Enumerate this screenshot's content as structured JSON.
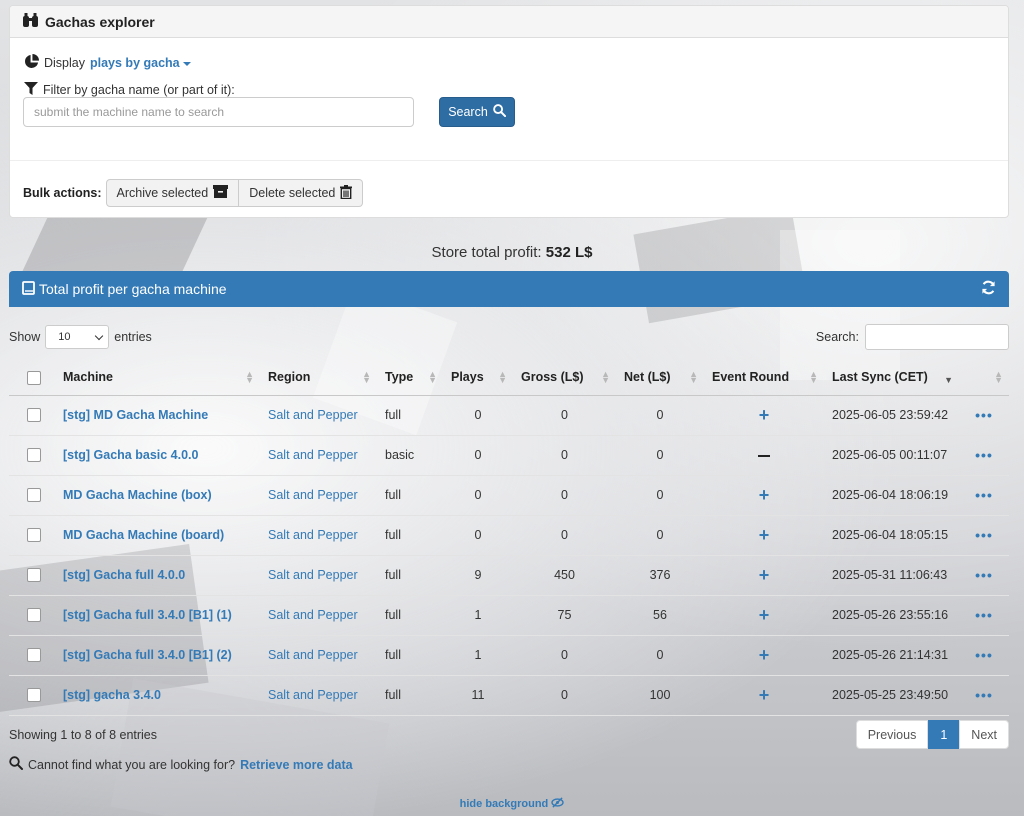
{
  "panel": {
    "title": "Gachas explorer",
    "display_label": "Display",
    "display_value": "plays by gacha",
    "filter_label": "Filter by gacha name (or part of it):",
    "search_placeholder": "submit the machine name to search",
    "search_button": "Search",
    "bulk_label": "Bulk actions:",
    "archive_button": "Archive selected",
    "delete_button": "Delete selected"
  },
  "store_profit": {
    "label": "Store total profit:",
    "value": "532 L$"
  },
  "table_panel": {
    "title": "Total profit per gacha machine",
    "show_label": "Show",
    "entries_count": "10",
    "entries_label": "entries",
    "search_label": "Search:",
    "columns": [
      "Machine",
      "Region",
      "Type",
      "Plays",
      "Gross (L$)",
      "Net (L$)",
      "Event Round",
      "Last Sync (CET)"
    ],
    "rows": [
      {
        "machine": "[stg] MD Gacha Machine",
        "region": "Salt and Pepper",
        "type": "full",
        "plays": "0",
        "gross": "0",
        "net": "0",
        "event": "plus",
        "sync": "2025-06-05 23:59:42"
      },
      {
        "machine": "[stg] Gacha basic 4.0.0",
        "region": "Salt and Pepper",
        "type": "basic",
        "plays": "0",
        "gross": "0",
        "net": "0",
        "event": "minus",
        "sync": "2025-06-05 00:11:07"
      },
      {
        "machine": "MD Gacha Machine (box)",
        "region": "Salt and Pepper",
        "type": "full",
        "plays": "0",
        "gross": "0",
        "net": "0",
        "event": "plus",
        "sync": "2025-06-04 18:06:19"
      },
      {
        "machine": "MD Gacha Machine (board)",
        "region": "Salt and Pepper",
        "type": "full",
        "plays": "0",
        "gross": "0",
        "net": "0",
        "event": "plus",
        "sync": "2025-06-04 18:05:15"
      },
      {
        "machine": "[stg] Gacha full 4.0.0",
        "region": "Salt and Pepper",
        "type": "full",
        "plays": "9",
        "gross": "450",
        "net": "376",
        "event": "plus",
        "sync": "2025-05-31 11:06:43"
      },
      {
        "machine": "[stg] Gacha full 3.4.0 [B1] (1)",
        "region": "Salt and Pepper",
        "type": "full",
        "plays": "1",
        "gross": "75",
        "net": "56",
        "event": "plus",
        "sync": "2025-05-26 23:55:16"
      },
      {
        "machine": "[stg] Gacha full 3.4.0 [B1] (2)",
        "region": "Salt and Pepper",
        "type": "full",
        "plays": "1",
        "gross": "0",
        "net": "0",
        "event": "plus",
        "sync": "2025-05-26 21:14:31"
      },
      {
        "machine": "[stg] gacha 3.4.0",
        "region": "Salt and Pepper",
        "type": "full",
        "plays": "11",
        "gross": "0",
        "net": "100",
        "event": "plus",
        "sync": "2025-05-25 23:49:50"
      }
    ],
    "info": "Showing 1 to 8 of 8 entries",
    "prev": "Previous",
    "current_page": "1",
    "next": "Next"
  },
  "footer": {
    "cannot_find": "Cannot find what you are looking for?",
    "retrieve_link": "Retrieve more data",
    "hide_bg": "hide background"
  },
  "colors": {
    "primary": "#337ab7",
    "primary_dark": "#2e6da4"
  }
}
